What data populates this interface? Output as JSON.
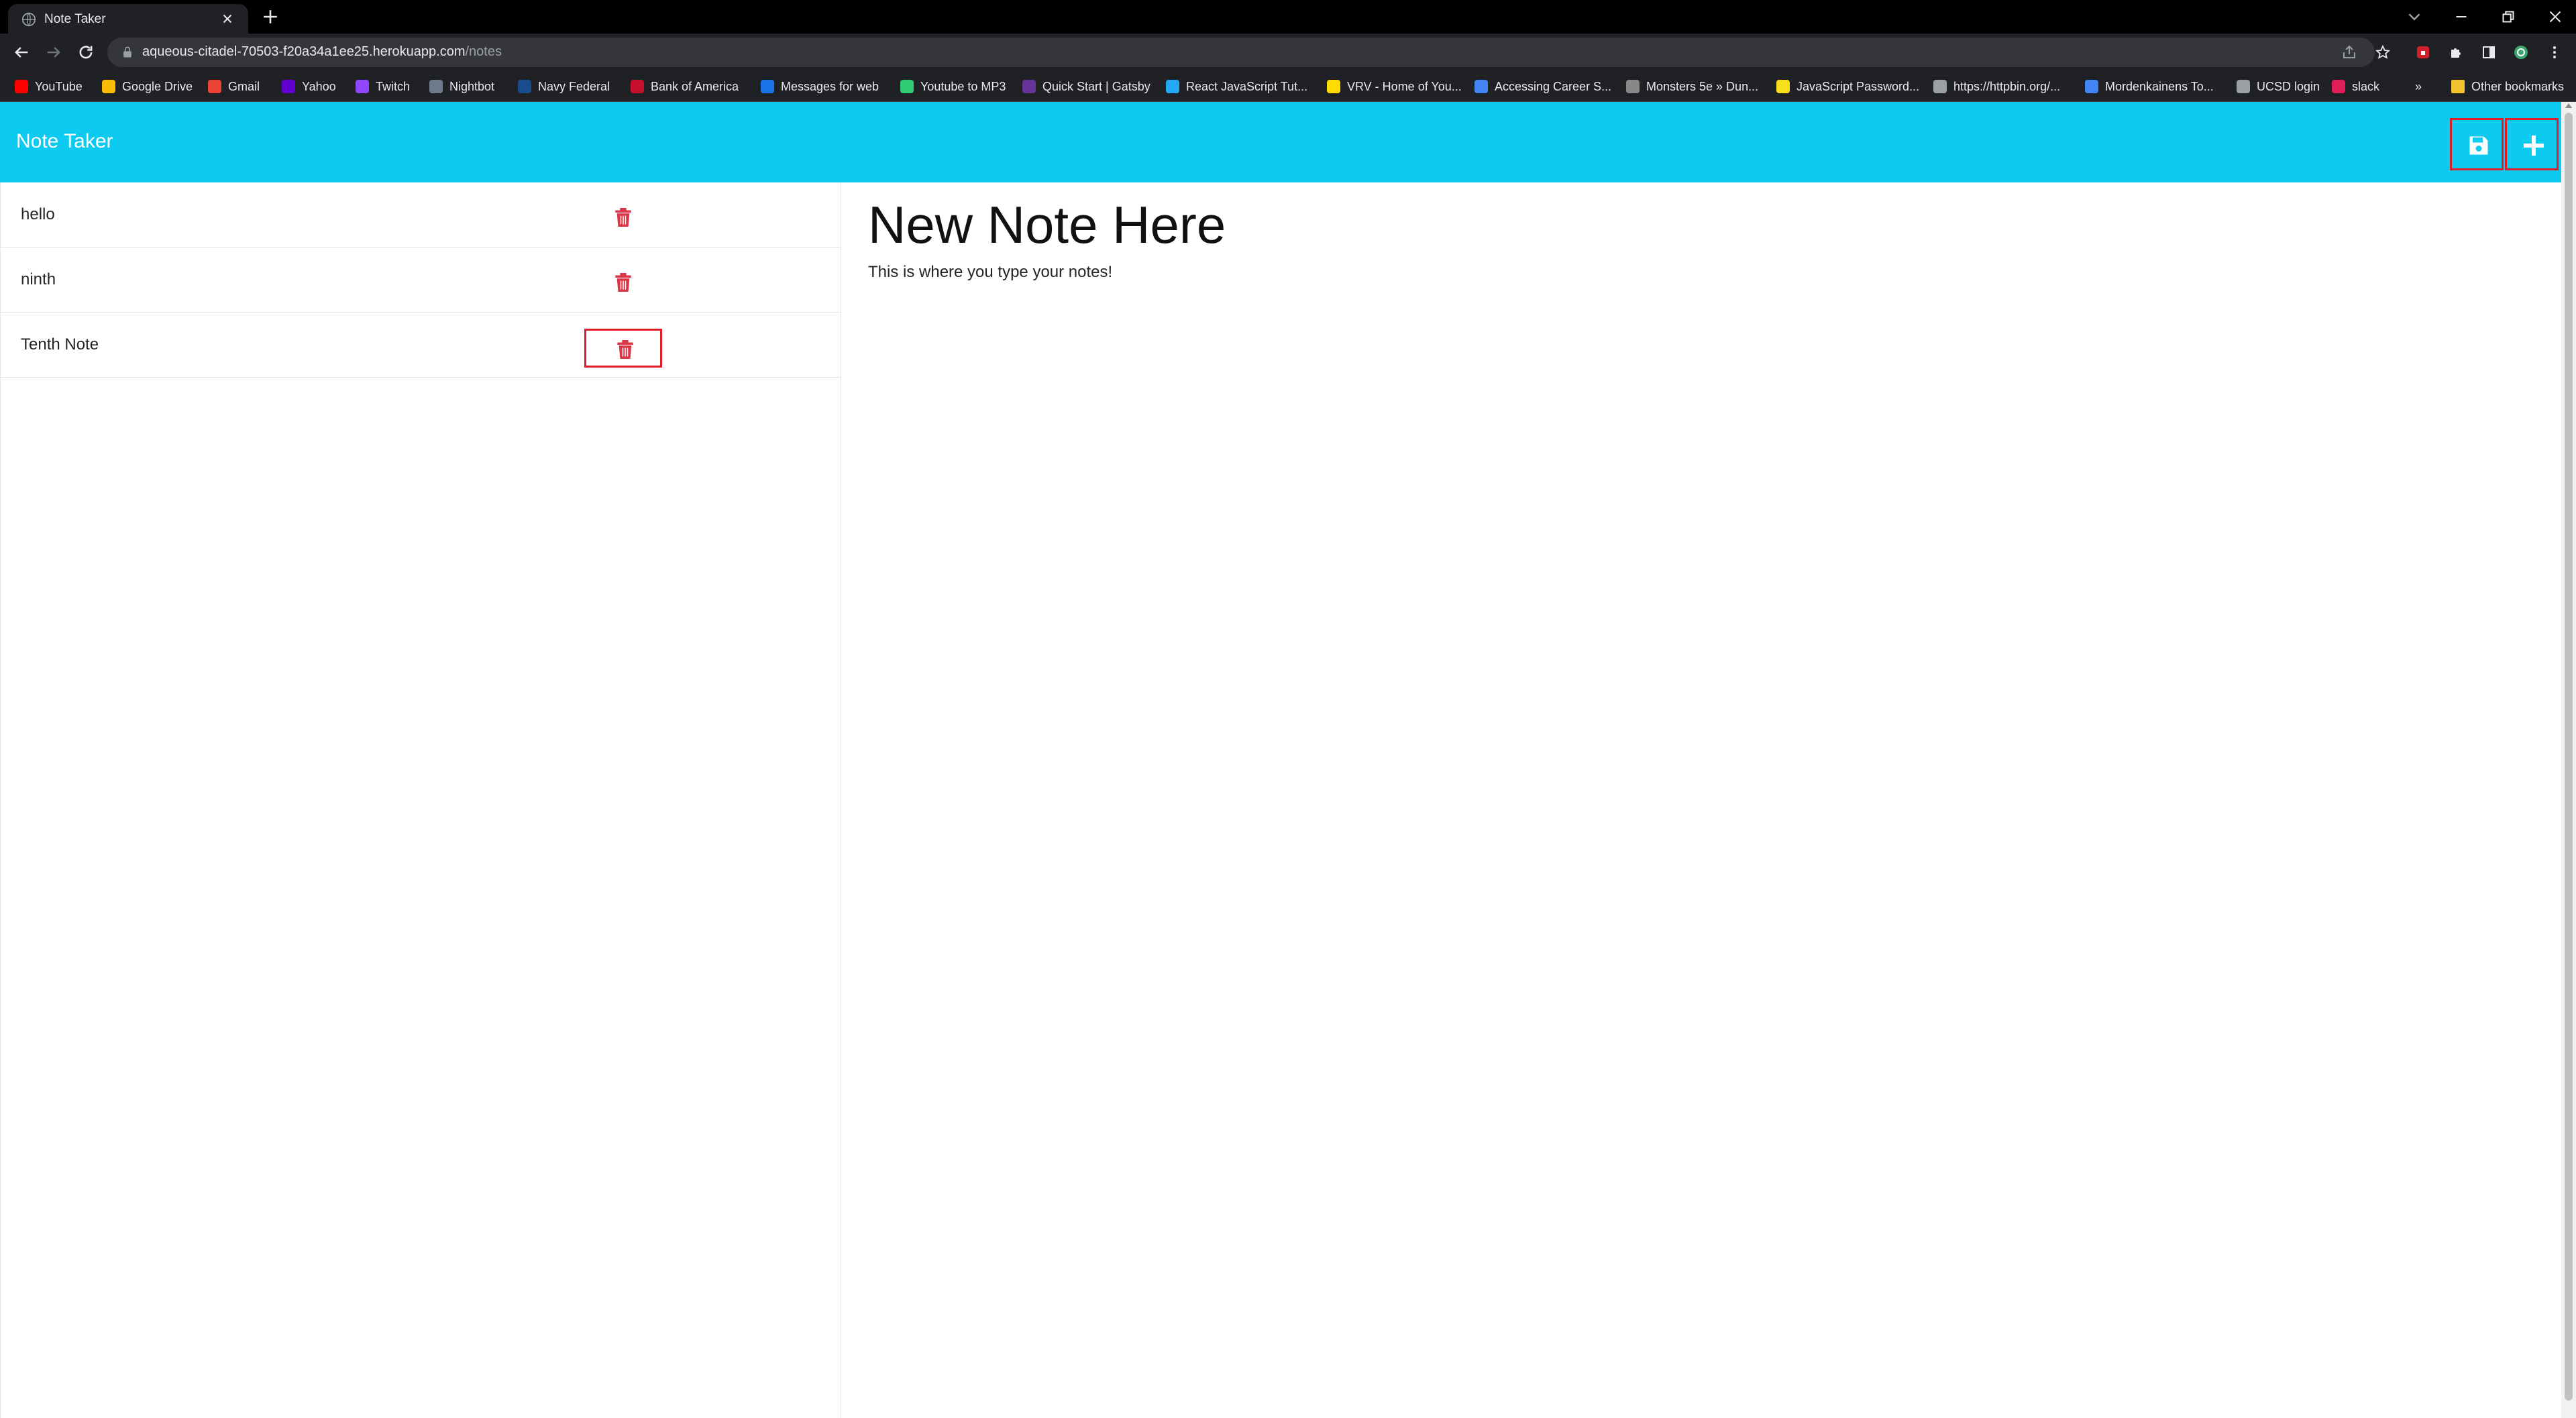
{
  "browser": {
    "tab_title": "Note Taker",
    "url_host": "aqueous-citadel-70503-f20a34a1ee25.herokuapp.com",
    "url_path": "/notes",
    "bookmarks": [
      {
        "label": "YouTube",
        "icon": "youtube-icon",
        "color": "#ff0000"
      },
      {
        "label": "Google Drive",
        "icon": "google-drive-icon",
        "color": "#fbbc04"
      },
      {
        "label": "Gmail",
        "icon": "gmail-icon",
        "color": "#ea4335"
      },
      {
        "label": "Yahoo",
        "icon": "yahoo-icon",
        "color": "#6001d2"
      },
      {
        "label": "Twitch",
        "icon": "twitch-icon",
        "color": "#9146ff"
      },
      {
        "label": "Nightbot",
        "icon": "nightbot-icon",
        "color": "#6c7a89"
      },
      {
        "label": "Navy Federal",
        "icon": "navy-federal-icon",
        "color": "#1a4b8c"
      },
      {
        "label": "Bank of America",
        "icon": "bank-of-america-icon",
        "color": "#c8102e"
      },
      {
        "label": "Messages for web",
        "icon": "messages-icon",
        "color": "#1a73e8"
      },
      {
        "label": "Youtube to MP3",
        "icon": "mp3-icon",
        "color": "#2ecc71"
      },
      {
        "label": "Quick Start | Gatsby",
        "icon": "gatsby-icon",
        "color": "#663399"
      },
      {
        "label": "React JavaScript Tut...",
        "icon": "vscode-icon",
        "color": "#23a9f2"
      },
      {
        "label": "VRV - Home of You...",
        "icon": "vrv-icon",
        "color": "#ffdd00"
      },
      {
        "label": "Accessing Career S...",
        "icon": "career-icon",
        "color": "#4285f4"
      },
      {
        "label": "Monsters 5e » Dun...",
        "icon": "monster-icon",
        "color": "#888888"
      },
      {
        "label": "JavaScript Password...",
        "icon": "js-password-icon",
        "color": "#f7df1e"
      },
      {
        "label": "https://httpbin.org/...",
        "icon": "globe-icon",
        "color": "#9aa0a6"
      },
      {
        "label": "Mordenkainens To...",
        "icon": "search-icon",
        "color": "#4285f4"
      },
      {
        "label": "UCSD login",
        "icon": "globe-icon",
        "color": "#9aa0a6"
      },
      {
        "label": "slack",
        "icon": "slack-icon",
        "color": "#e01e5a"
      }
    ],
    "bookmarks_overflow": "»",
    "other_bookmarks": "Other bookmarks"
  },
  "app": {
    "brand": "Note Taker",
    "accent_color": "#0ccaf0",
    "danger_color": "#dc3545",
    "notes": [
      {
        "title": "hello",
        "highlighted": false
      },
      {
        "title": "ninth",
        "highlighted": false
      },
      {
        "title": "Tenth Note",
        "highlighted": true
      }
    ],
    "editor": {
      "title_placeholder": "New Note Here",
      "body_placeholder": "This is where you type your notes!"
    }
  }
}
